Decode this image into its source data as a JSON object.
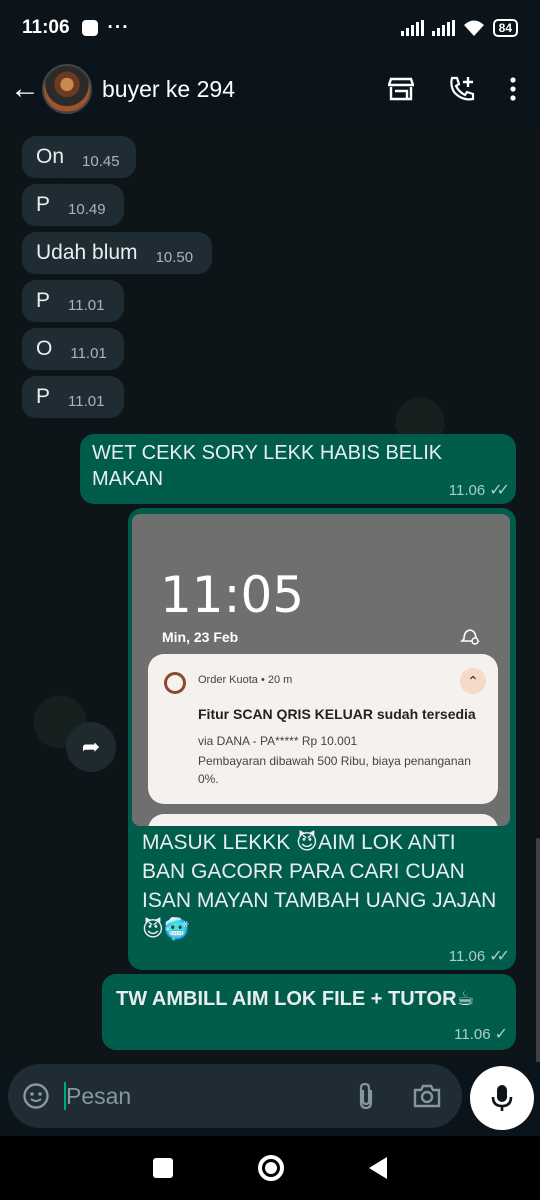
{
  "status": {
    "time": "11:06",
    "extra": "···",
    "battery": "84"
  },
  "header": {
    "contact_name": "buyer ke 294"
  },
  "messages_in": [
    {
      "text": "On",
      "time": "10.45"
    },
    {
      "text": "P",
      "time": "10.49"
    },
    {
      "text": "Udah blum",
      "time": "10.50"
    },
    {
      "text": "P",
      "time": "11.01"
    },
    {
      "text": "O",
      "time": "11.01"
    },
    {
      "text": "P",
      "time": "11.01"
    }
  ],
  "messages_out": [
    {
      "text": "WET CEKK SORY LEKK HABIS BELIK MAKAN",
      "time": "11.06",
      "status": "read"
    },
    {
      "text": "MASUK LEKKK 😈AIM LOK ANTI BAN GACORR PARA CARI CUAN ISAN MAYAN TAMBAH UANG JAJAN 😈🥶",
      "time": "11.06",
      "status": "read"
    },
    {
      "text": "TW AMBILL AIM LOK FILE + TUTOR☕",
      "time": "11.06",
      "status": "sent"
    }
  ],
  "screenshot": {
    "clock": "11:05",
    "date": "Min, 23 Feb",
    "notification": {
      "app": "Order Kuota • 20 m",
      "title": "Fitur SCAN QRIS KELUAR sudah tersedia",
      "line1": "via DANA - PA***** Rp 10.001",
      "line2": "Pembayaran dibawah 500 Ribu, biaya penanganan 0%."
    }
  },
  "input": {
    "placeholder": "Pesan"
  },
  "colors": {
    "outgoing": "#005c4b",
    "incoming": "#202c33",
    "accent": "#00a884"
  }
}
